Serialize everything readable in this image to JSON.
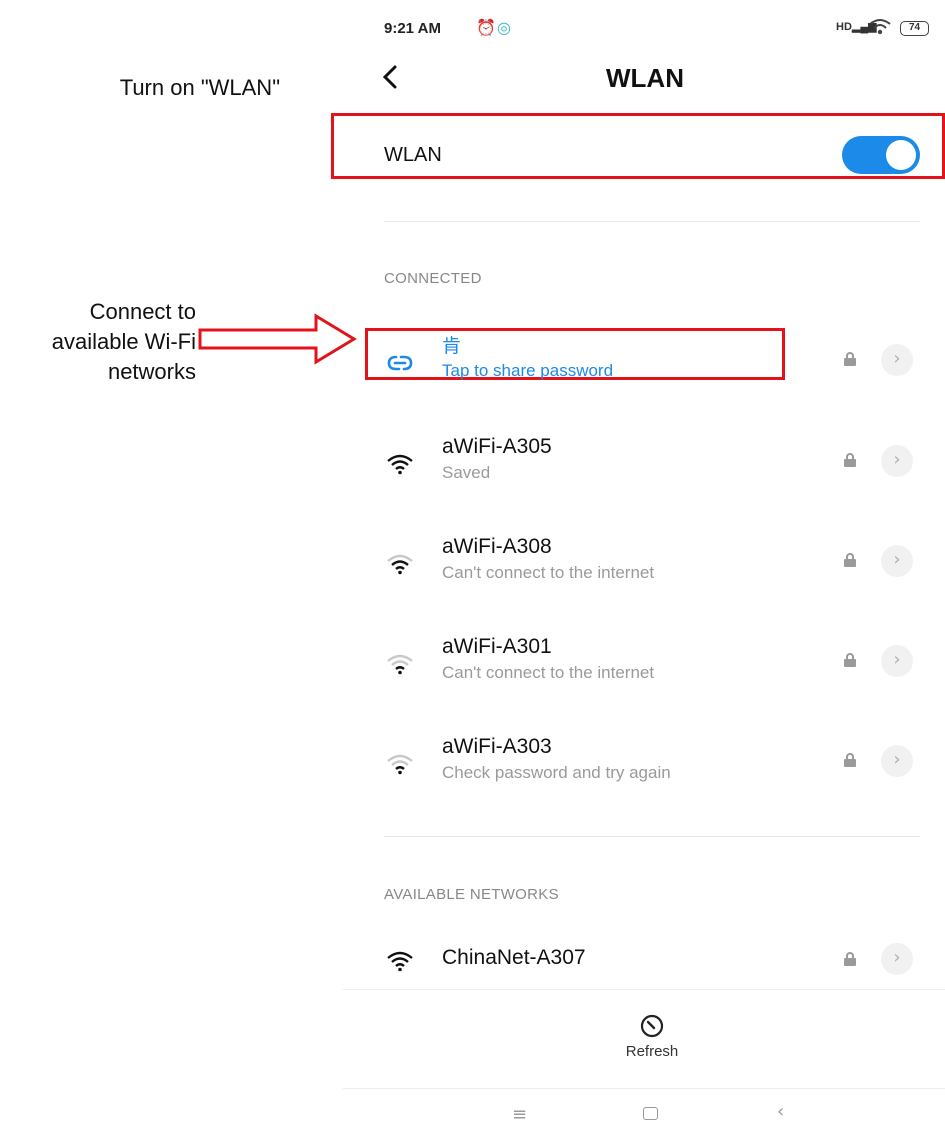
{
  "annotations": {
    "turn_on_label": "Turn on \"WLAN\"",
    "connect_label_lines": [
      "Connect to",
      "available Wi-Fi",
      "networks"
    ],
    "highlight_color": "#e3121b"
  },
  "status_bar": {
    "time": "9:21 AM",
    "signal_label": "HD",
    "battery_level": "74"
  },
  "header": {
    "back_icon": "back-arrow-icon",
    "title": "WLAN"
  },
  "wlan": {
    "label": "WLAN",
    "enabled": true,
    "accent_color": "#1b8ae8"
  },
  "sections": {
    "connected_title": "CONNECTED",
    "available_title": "AVAILABLE NETWORKS"
  },
  "connected_network": {
    "name": "肯",
    "subtitle": "Tap to share password",
    "icon": "link-icon"
  },
  "saved_networks": [
    {
      "name": "aWiFi-A305",
      "subtitle": "Saved",
      "signal": 3
    },
    {
      "name": "aWiFi-A308",
      "subtitle": "Can't connect to the internet",
      "signal": 2
    },
    {
      "name": "aWiFi-A301",
      "subtitle": "Can't connect to the internet",
      "signal": 1
    },
    {
      "name": "aWiFi-A303",
      "subtitle": "Check password and try again",
      "signal": 1
    }
  ],
  "available_networks": [
    {
      "name": "ChinaNet-A307",
      "signal": 3
    }
  ],
  "footer": {
    "refresh_label": "Refresh"
  },
  "nav": {
    "menu_glyph": "≡",
    "back_glyph": "‹"
  }
}
